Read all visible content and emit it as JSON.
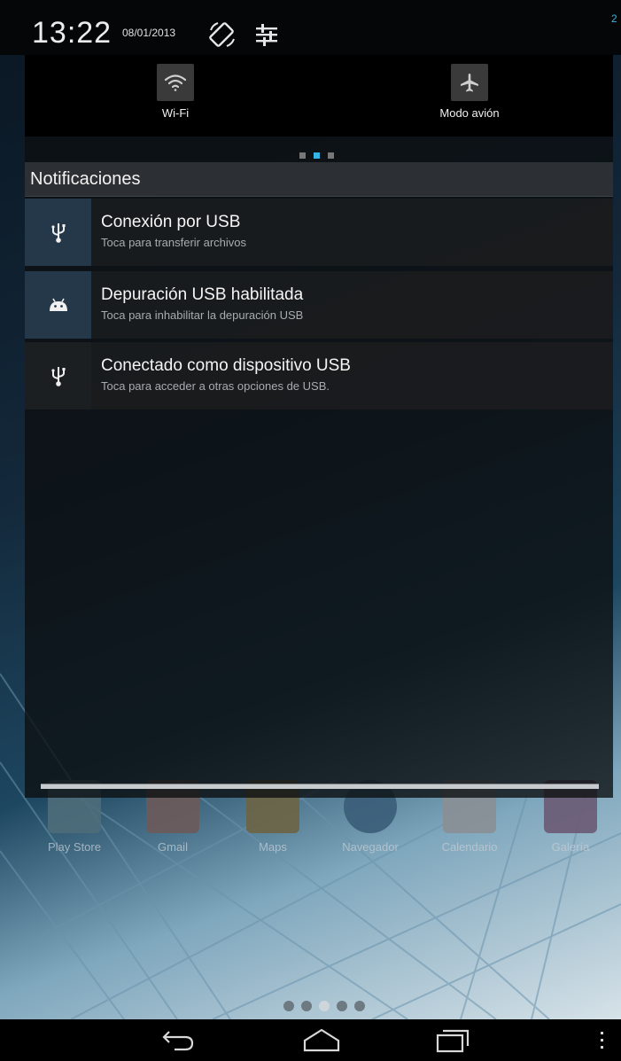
{
  "status": {
    "time": "13:22",
    "date": "08/01/2013",
    "edge_text": "2"
  },
  "quick_settings": {
    "tiles": [
      {
        "label": "Wi-Fi",
        "icon": "wifi-icon"
      },
      {
        "label": "Modo avión",
        "icon": "airplane-icon"
      }
    ],
    "page_indicator": {
      "pages": 3,
      "current": 2
    }
  },
  "notifications": {
    "header": "Notificaciones",
    "items": [
      {
        "title": "Conexión por USB",
        "subtitle": "Toca para transferir archivos",
        "icon": "usb-icon"
      },
      {
        "title": "Depuración USB habilitada",
        "subtitle": "Toca para inhabilitar la depuración USB",
        "icon": "android-debug-icon"
      },
      {
        "title": "Conectado como dispositivo USB",
        "subtitle": "Toca para acceder a otras opciones de USB.",
        "icon": "usb-icon"
      }
    ]
  },
  "home": {
    "dock": [
      {
        "label": "Play Store"
      },
      {
        "label": "Gmail"
      },
      {
        "label": "Maps"
      },
      {
        "label": "Navegador"
      },
      {
        "label": "Calendario"
      },
      {
        "label": "Galería"
      }
    ]
  },
  "navbar": {
    "buttons": [
      "back-icon",
      "home-icon",
      "recents-icon",
      "menu-icon"
    ]
  },
  "colors": {
    "accent": "#33b5e5",
    "notification_icon_bg": "#24384a"
  }
}
